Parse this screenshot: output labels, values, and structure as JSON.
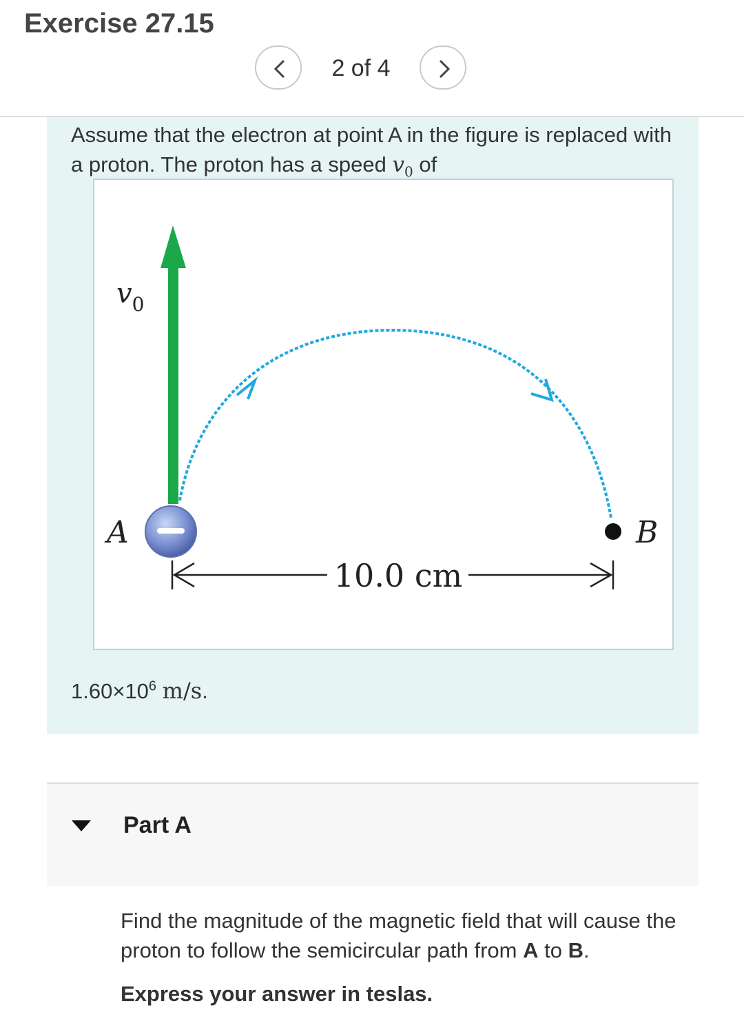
{
  "header": {
    "title": "Exercise 27.15",
    "pager": "2 of 4"
  },
  "problem": {
    "intro_text": "Assume that the electron at point A in the figure is replaced with a proton. The proton has a speed",
    "intro_var": "v",
    "intro_var_sub": "0",
    "intro_end": "of",
    "speed_mantissa": "1.60×10",
    "speed_exp": "6",
    "speed_unit": "m/s",
    "speed_period": "."
  },
  "figure": {
    "label_v0": "v",
    "label_v0_sub": "0",
    "label_a": "A",
    "label_b": "B",
    "distance": "10.0 cm",
    "charge_sign": "−",
    "colors": {
      "arrow": "#1aa84a",
      "path": "#1ea9df",
      "charge": "#6f86c8"
    }
  },
  "part_a": {
    "label": "Part A",
    "question_start": "Find the magnitude of the magnetic field that will cause the proton to follow the semicircular path from",
    "point_a": "A",
    "to": "to",
    "point_b": "B",
    "end": ".",
    "instruction": "Express your answer in teslas."
  }
}
